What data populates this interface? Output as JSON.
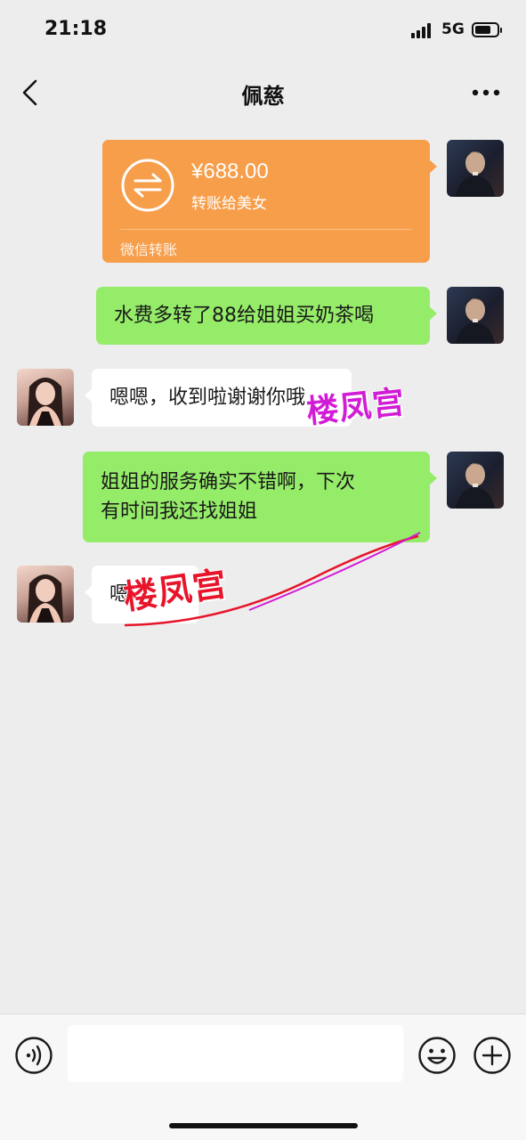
{
  "status_bar": {
    "time": "21:18",
    "network": "5G"
  },
  "header": {
    "title": "佩慈"
  },
  "messages": [
    {
      "type": "transfer",
      "side": "right",
      "amount": "¥688.00",
      "note": "转账给美女",
      "footer": "微信转账"
    },
    {
      "type": "text",
      "side": "right",
      "text": "水费多转了88给姐姐买奶茶喝"
    },
    {
      "type": "text",
      "side": "left",
      "text": "嗯嗯，收到啦谢谢你哦"
    },
    {
      "type": "text",
      "side": "right",
      "line1": "姐姐的服务确实不错啊，下次",
      "line2": "有时间我还找姐姐"
    },
    {
      "type": "text",
      "side": "left",
      "text": "嗯"
    }
  ],
  "watermark": {
    "text_top": "楼凤宫",
    "text_bottom": "楼凤宫",
    "color_top": "#d21bd6",
    "color_bottom": "#e8142a"
  },
  "input_bar": {
    "placeholder": ""
  },
  "colors": {
    "background": "#ededed",
    "sent_bubble": "#95ec69",
    "received_bubble": "#ffffff",
    "transfer_card": "#f79e4a"
  }
}
